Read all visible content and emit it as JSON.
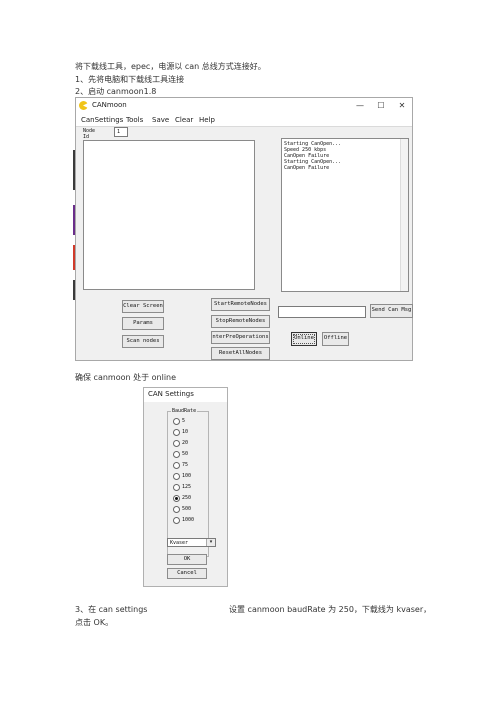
{
  "doc": {
    "line1": "将下载线工具，epec，电源以 can 总线方式连接好。",
    "line2": "1、先将电脑和下载线工具连接",
    "line3": "2、启动 canmoon1.8",
    "line4": "确保 canmoon  处于 online",
    "line5a": "3、在 can settings",
    "line5b": "设置 canmoon baudRate 为 250，下载线为 kvaser，",
    "line6": "点击 OK。"
  },
  "canmoon": {
    "title": "CANmoon",
    "controls": {
      "minimize": "—",
      "maximize": "☐",
      "close": "✕"
    },
    "menu": [
      "CanSettings",
      "Tools",
      "Save",
      "Clear",
      "Help"
    ],
    "node_label": "Node\nId",
    "node_label_1": "Node",
    "node_label_2": "Id",
    "node_value": "1",
    "log": [
      "Starting CanOpen...",
      "Speed 250 kbps",
      "CanOpen Failure",
      "Starting CanOpen...",
      "CanOpen Failure"
    ],
    "buttons": {
      "clear_screen": "Clear Screen",
      "params": "Params",
      "scan_nodes": "Scan nodes",
      "start_remote": "StartRemoteNodes",
      "stop_remote": "StopRemoteNodes",
      "enter_preop": "nterPreOperations",
      "reset_all": "ResetAllNodes",
      "send_can_msg": "Send Can Msg",
      "online": "Online",
      "offline": "Offline"
    },
    "msg_input": ""
  },
  "settings": {
    "title": "CAN Settings",
    "group": "BaudRate",
    "rates": [
      "5",
      "10",
      "20",
      "50",
      "75",
      "100",
      "125",
      "250",
      "500",
      "1000"
    ],
    "selected": "250",
    "driver": "Kvaser",
    "ok": "OK",
    "cancel": "Cancel"
  },
  "colors": {
    "edge_strip": [
      "#3a3a3a",
      "#6a2d8a",
      "#d03a2a",
      "#e0a020",
      "#3a3a3a"
    ]
  }
}
